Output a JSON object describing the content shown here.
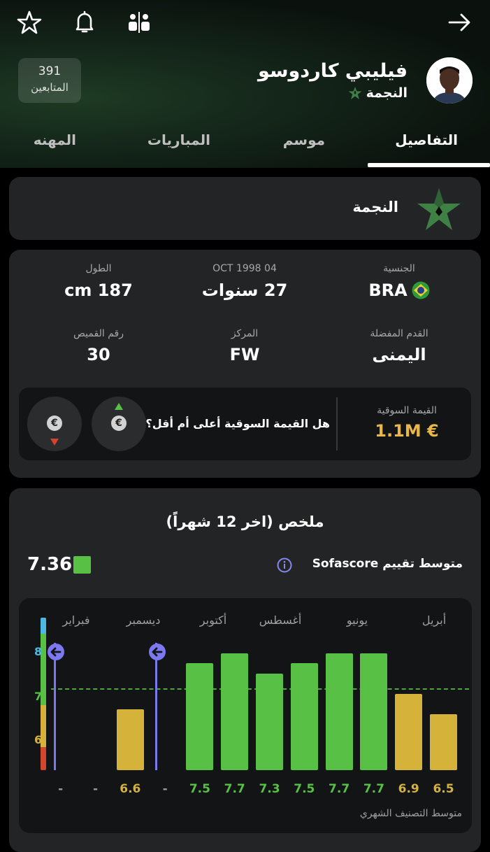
{
  "header": {
    "followers_count": "391",
    "followers_label": "المتابعين",
    "player_name": "فيليبي كاردوسو",
    "team_name": "النجمة",
    "tabs": [
      "التفاصيل",
      "موسم",
      "المباريات",
      "المهنه"
    ],
    "active_tab": "التفاصيل"
  },
  "team_card": {
    "name": "النجمة"
  },
  "details": {
    "nationality_label": "الجنسية",
    "nationality_value": "BRA",
    "birthdate_label": "04 OCT 1998",
    "age_value": "27 سنوات",
    "height_label": "الطول",
    "height_value": "187 cm",
    "foot_label": "القدم المفضلة",
    "foot_value": "اليمنى",
    "position_label": "المركز",
    "position_value": "FW",
    "shirt_label": "رقم القميص",
    "shirt_value": "30"
  },
  "market": {
    "label": "القيمة السوقية",
    "value": "1.1M €",
    "question": "هل القيمة السوقية أعلى أم أقل؟",
    "coin_symbol": "€"
  },
  "summary": {
    "title": "ملخص (اخر 12 شهراً)",
    "avg_label": "متوسط تقييم Sofascore",
    "avg_value": "7.36",
    "footer": "متوسط التصنيف الشهري"
  },
  "chart_data": {
    "type": "bar",
    "months": [
      "أبريل",
      "يونيو",
      "أغسطس",
      "أكتوبر",
      "ديسمبر",
      "فبراير"
    ],
    "values": [
      6.5,
      6.9,
      7.7,
      7.7,
      7.5,
      7.3,
      7.7,
      7.5,
      null,
      6.6,
      null,
      null
    ],
    "labels": [
      "6.5",
      "6.9",
      "7.7",
      "7.7",
      "7.5",
      "7.3",
      "7.7",
      "7.5",
      "-",
      "6.6",
      "-",
      "-"
    ],
    "y_ticks": [
      "8",
      "7",
      "6"
    ],
    "ylim": [
      5.4,
      8.4
    ],
    "average": 7.36,
    "colors": {
      "high": "#58c145",
      "mid": "#d5b23a",
      "low": "#d3452e",
      "top": "#4fb8e0",
      "marker": "#7b78f0"
    }
  },
  "colors": {
    "accent": "#e8b64a",
    "green": "#58c145"
  }
}
